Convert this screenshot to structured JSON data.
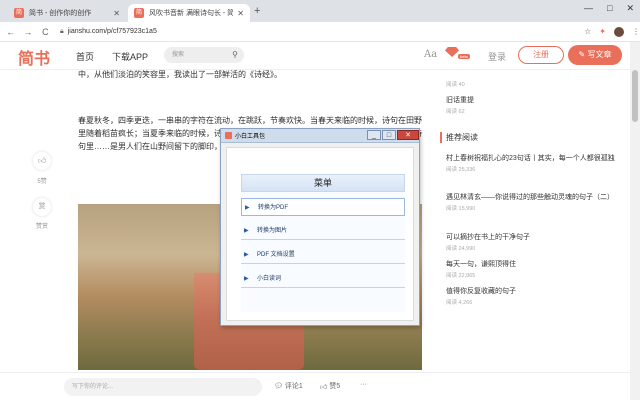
{
  "browser": {
    "tabs": [
      {
        "label": "简书 - 创作你的创作",
        "active": false
      },
      {
        "label": "风吹书音新 满眼诗句长 - 简书",
        "active": true
      }
    ],
    "new_tab": "+",
    "window_controls": [
      "—",
      "□",
      "✕"
    ],
    "url": "jianshu.com/p/cf757923c1a5",
    "back": "←",
    "forward": "→",
    "reload": "C"
  },
  "site": {
    "logo": "简书",
    "nav": {
      "home": "首页",
      "app": "下载APP"
    },
    "search_placeholder": "搜索",
    "font_toggle": "Aa",
    "beta": "beta",
    "login": "登录",
    "signup": "注册",
    "write": "写文章"
  },
  "article": {
    "p1": "中，从他们淡泊的笑容里，我读出了一部鲜活的《诗经》。",
    "p2": "春夏秋冬，四季更迭，一串串的字符在流动，在跳跃，节奏欢快。当春天来临的时候，诗句在田野里随着稻苗疯长；当夏季来临的时候，诗句随着杨柳翠叶……的笑语；秋天更是收获的季节呀，诗句里……是男人们在山野间留下的脚印，是女人们……"
  },
  "actions": {
    "like_icon": "thumbs-up-icon",
    "like_count": "5赞",
    "reward_icon": "reward-icon",
    "reward_char": "赏",
    "reward_label": "赞赏"
  },
  "sidebar": {
    "top_items": [
      {
        "meta": "阅读 40"
      },
      {
        "title": "旧话重提",
        "meta": "阅读 62"
      }
    ],
    "section_title": "推荐阅读",
    "items": [
      {
        "title": "村上春树祝福扎心的23句话丨其实，每一个人都很孤独",
        "meta": "阅读 25,336"
      },
      {
        "title": "遇见林清玄——你说得过的那些触动灵魂的句子（二）",
        "meta": "阅读 15,990"
      },
      {
        "title": "可以摘抄在书上的干净句子",
        "meta": "阅读 24,990"
      },
      {
        "title": "每天一句，谦熙顶得住",
        "meta": "阅读 22,865"
      },
      {
        "title": "值得你反复收藏的句子",
        "meta": "阅读 4,266"
      }
    ]
  },
  "bottom_bar": {
    "comment_placeholder": "写下你的评论...",
    "comment_label": "评论1",
    "like_label": "赞5",
    "more": "···"
  },
  "popup": {
    "title": "小白工具包",
    "title_behind": "风吹书音新 满眼诗句长",
    "controls": [
      "_",
      "□",
      "✕"
    ],
    "menu_title": "菜单",
    "items": [
      {
        "label": "转换为PDF",
        "selected": true
      },
      {
        "label": "转换为图片",
        "selected": false
      },
      {
        "label": "PDF 文档设置",
        "selected": false
      },
      {
        "label": "小白读词",
        "selected": false
      }
    ]
  },
  "colors": {
    "brand": "#ea6f5a",
    "popup_border": "#8aa1c0",
    "menu_text": "#1b3a66"
  }
}
